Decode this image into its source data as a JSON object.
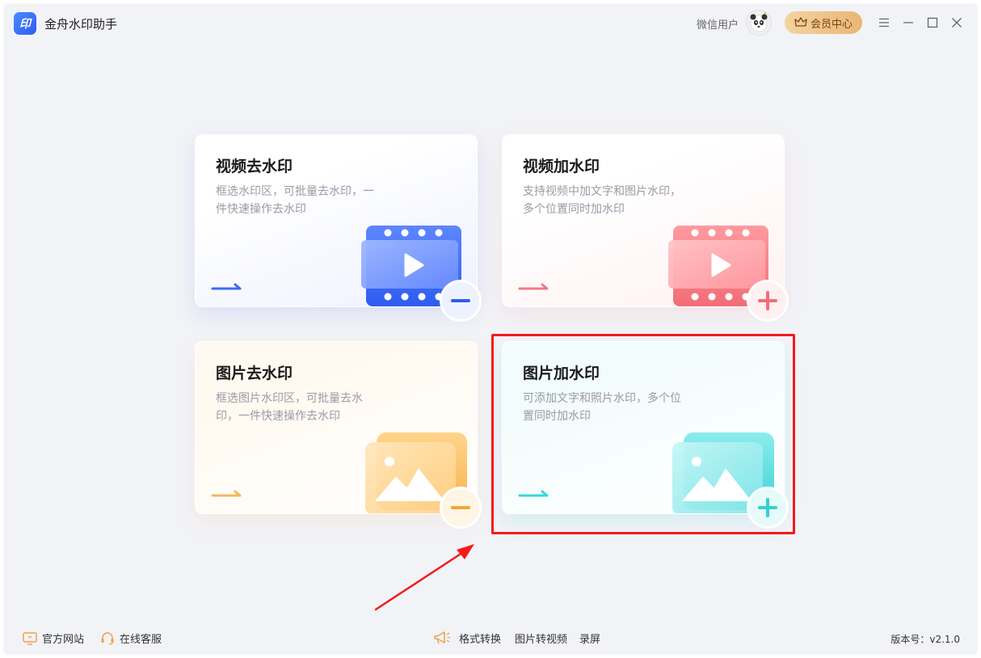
{
  "app": {
    "title": "金舟水印助手",
    "logo_text": "印"
  },
  "header": {
    "user_name": "微信用户",
    "vip_label": "会员中心"
  },
  "cards": [
    {
      "title": "视频去水印",
      "desc": "框选水印区，可批量去水印，一件快速操作去水印",
      "accent": "#3b6cf2",
      "action": "minus"
    },
    {
      "title": "视频加水印",
      "desc": "支持视频中加文字和图片水印，多个位置同时加水印",
      "accent": "#f27a80",
      "action": "plus"
    },
    {
      "title": "图片去水印",
      "desc": "框选图片水印区，可批量去水印，一件快速操作去水印",
      "accent": "#f3b95a",
      "action": "minus"
    },
    {
      "title": "图片加水印",
      "desc": "可添加文字和照片水印，多个位置同时加水印",
      "accent": "#3dd6d6",
      "action": "plus"
    }
  ],
  "footer": {
    "website": "官方网站",
    "support": "在线客服",
    "format_convert": "格式转换",
    "image_to_video": "图片转视频",
    "record_screen": "录屏",
    "version": "版本号：v2.1.0"
  },
  "colors": {
    "highlight": "#f41b1b",
    "vip_gradient_start": "#f5d3a0",
    "vip_gradient_end": "#e9b676"
  }
}
